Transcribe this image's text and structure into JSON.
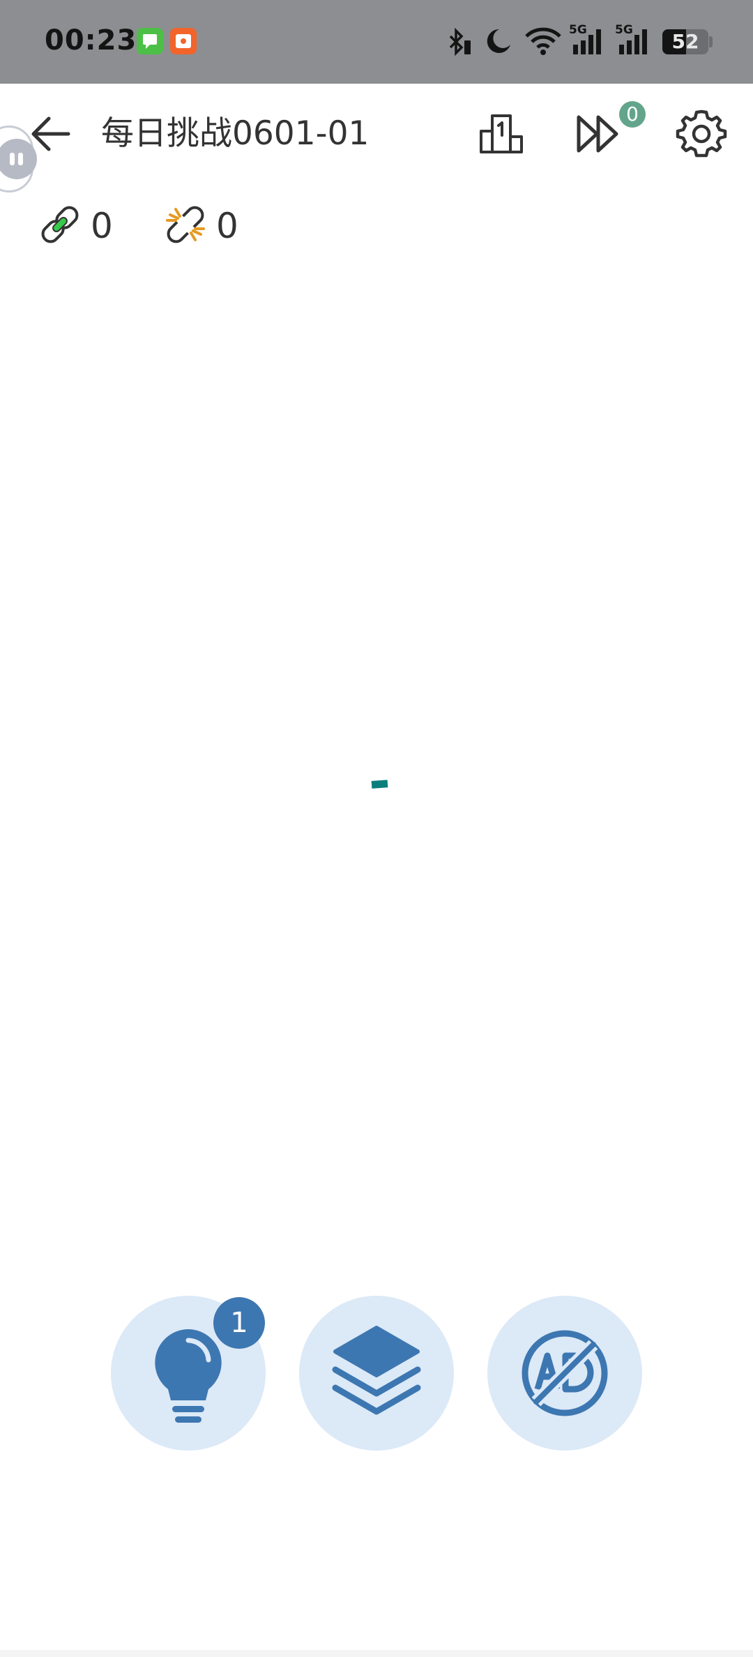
{
  "status_bar": {
    "time": "00:23",
    "battery_level": "52",
    "network_label_1": "5G",
    "network_label_2": "5G",
    "icons": [
      "messages-icon",
      "app-notification-icon",
      "bluetooth-icon",
      "moon-icon",
      "wifi-icon",
      "signal-5g-icon",
      "signal-5g-icon",
      "battery-icon"
    ]
  },
  "header": {
    "title": "每日挑战0601-01",
    "skip_badge_count": "0",
    "icons": [
      "back-arrow-icon",
      "leaderboard-icon",
      "skip-forward-icon",
      "gear-icon"
    ]
  },
  "counters": {
    "connected": "0",
    "broken": "0"
  },
  "actions": {
    "hint_badge_count": "1",
    "icons": [
      "lightbulb-icon",
      "layers-icon",
      "no-ads-icon"
    ]
  },
  "colors": {
    "accent_blue": "#3d77b1",
    "button_bg": "#dce9f7",
    "badge_green": "#63a58b",
    "piece_teal": "#0a7e7c",
    "status_bar_bg": "#8d8e91"
  }
}
